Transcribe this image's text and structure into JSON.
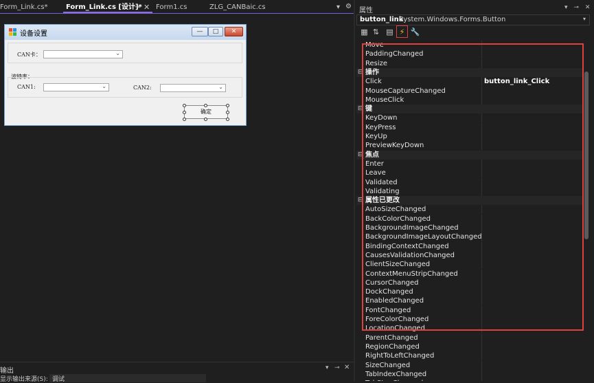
{
  "tabs": [
    {
      "label": "Form_Link.cs*",
      "active": false
    },
    {
      "label": "Form_Link.cs [设计]*",
      "active": true
    },
    {
      "label": "Form1.cs",
      "active": false
    },
    {
      "label": "ZLG_CANBaic.cs",
      "active": false
    }
  ],
  "tab_icons": {
    "pin": "pin-icon",
    "close": "close-icon",
    "dropdown": "chevron-down-icon",
    "settings": "gear-icon"
  },
  "form": {
    "title": "设备设置",
    "can_card_label": "CAN卡：",
    "baud_label": "波特率：",
    "can1_label": "CAN1:",
    "can2_label": "CAN2:",
    "ok_label": "确定",
    "min": "—",
    "max": "□",
    "close": "✕"
  },
  "output": {
    "title": "输出",
    "source_label": "显示输出来源(S):",
    "source_value": "调试"
  },
  "properties": {
    "title": "属性",
    "object_name": "button_link",
    "object_type": "System.Windows.Forms.Button",
    "toolbar": [
      "categorized-icon",
      "alphabetical-icon",
      "properties-icon",
      "events-icon",
      "property-pages-icon"
    ],
    "rows": [
      {
        "name": "Move",
        "cat": false
      },
      {
        "name": "PaddingChanged",
        "cat": false
      },
      {
        "name": "Resize",
        "cat": false
      },
      {
        "name": "操作",
        "cat": true
      },
      {
        "name": "Click",
        "cat": false,
        "value": "button_link_Click"
      },
      {
        "name": "MouseCaptureChanged",
        "cat": false
      },
      {
        "name": "MouseClick",
        "cat": false
      },
      {
        "name": "键",
        "cat": true
      },
      {
        "name": "KeyDown",
        "cat": false
      },
      {
        "name": "KeyPress",
        "cat": false
      },
      {
        "name": "KeyUp",
        "cat": false
      },
      {
        "name": "PreviewKeyDown",
        "cat": false
      },
      {
        "name": "焦点",
        "cat": true
      },
      {
        "name": "Enter",
        "cat": false
      },
      {
        "name": "Leave",
        "cat": false
      },
      {
        "name": "Validated",
        "cat": false
      },
      {
        "name": "Validating",
        "cat": false
      },
      {
        "name": "属性已更改",
        "cat": true
      },
      {
        "name": "AutoSizeChanged",
        "cat": false
      },
      {
        "name": "BackColorChanged",
        "cat": false
      },
      {
        "name": "BackgroundImageChanged",
        "cat": false
      },
      {
        "name": "BackgroundImageLayoutChanged",
        "cat": false
      },
      {
        "name": "BindingContextChanged",
        "cat": false
      },
      {
        "name": "CausesValidationChanged",
        "cat": false
      },
      {
        "name": "ClientSizeChanged",
        "cat": false
      },
      {
        "name": "ContextMenuStripChanged",
        "cat": false
      },
      {
        "name": "CursorChanged",
        "cat": false
      },
      {
        "name": "DockChanged",
        "cat": false
      },
      {
        "name": "EnabledChanged",
        "cat": false
      },
      {
        "name": "FontChanged",
        "cat": false
      },
      {
        "name": "ForeColorChanged",
        "cat": false
      },
      {
        "name": "LocationChanged",
        "cat": false
      },
      {
        "name": "ParentChanged",
        "cat": false
      },
      {
        "name": "RegionChanged",
        "cat": false
      },
      {
        "name": "RightToLeftChanged",
        "cat": false
      },
      {
        "name": "SizeChanged",
        "cat": false
      },
      {
        "name": "TabIndexChanged",
        "cat": false
      },
      {
        "name": "TabStopChanged",
        "cat": false
      }
    ]
  },
  "colors": {
    "accent": "#8b6fd6",
    "highlight_box": "#e04040",
    "background": "#1f1f1f"
  }
}
